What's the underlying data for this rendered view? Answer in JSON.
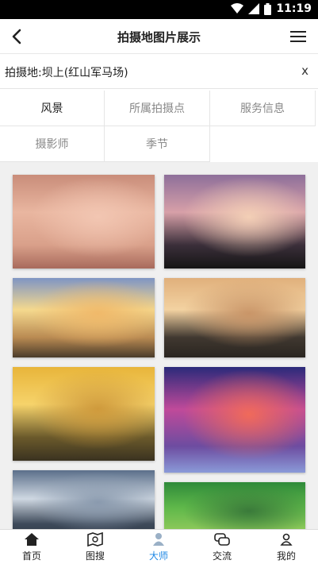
{
  "status_bar": {
    "time": "11:19"
  },
  "header": {
    "title": "拍摄地图片展示",
    "back_icon": "back-arrow-icon",
    "menu_icon": "menu-icon"
  },
  "filter": {
    "label": "拍摄地:坝上(红山军马场)",
    "clear": "x"
  },
  "tabs": [
    {
      "label": "风景",
      "active": true
    },
    {
      "label": "所属拍摄点",
      "active": false
    },
    {
      "label": "服务信息",
      "active": false
    },
    {
      "label": "摄影师",
      "active": false
    },
    {
      "label": "季节",
      "active": false
    }
  ],
  "photos": [
    {
      "name": "misty-hills-pink",
      "colors": [
        "#c98d7a",
        "#e9b6a0",
        "#f2c6b2",
        "#d9a08a",
        "#a86a5c"
      ]
    },
    {
      "name": "lone-tree-sunset",
      "colors": [
        "#8e6f9a",
        "#d7a0a8",
        "#f3cfb6",
        "#3b2f3a",
        "#151515"
      ]
    },
    {
      "name": "golden-sunrise-clouds",
      "colors": [
        "#7f95c4",
        "#f5d98e",
        "#f0b96a",
        "#b98a52",
        "#4a3b2a"
      ]
    },
    {
      "name": "forest-fog-orange",
      "colors": [
        "#e0b07c",
        "#f3d2a1",
        "#c99568",
        "#403830",
        "#2a2520"
      ]
    },
    {
      "name": "yellow-valley-fog",
      "colors": [
        "#e8b53a",
        "#f6d36b",
        "#cf9a3c",
        "#6b5a2b",
        "#3a3220"
      ]
    },
    {
      "name": "purple-red-sky-lake",
      "colors": [
        "#2b2a7a",
        "#c04a9a",
        "#f06a5a",
        "#6d4ca0",
        "#8a9ad8"
      ]
    },
    {
      "name": "storm-clouds-light",
      "colors": [
        "#5b6f8a",
        "#cfd8e2",
        "#8a9aae",
        "#3e4a5a",
        "#2a3240"
      ]
    },
    {
      "name": "green-field-rows",
      "colors": [
        "#2f8a3a",
        "#5fb84a",
        "#3a7a3a",
        "#8cc85a",
        "#2a5a2a"
      ]
    }
  ],
  "bottom_nav": [
    {
      "label": "首页",
      "icon": "home-icon",
      "active": false
    },
    {
      "label": "图搜",
      "icon": "map-search-icon",
      "active": false
    },
    {
      "label": "大师",
      "icon": "master-icon",
      "active": true
    },
    {
      "label": "交流",
      "icon": "chat-icon",
      "active": false
    },
    {
      "label": "我的",
      "icon": "profile-icon",
      "active": false
    }
  ],
  "colors": {
    "accent": "#1e88e5",
    "status_bar": "#000000",
    "grid_bg": "#f0f0f0"
  }
}
